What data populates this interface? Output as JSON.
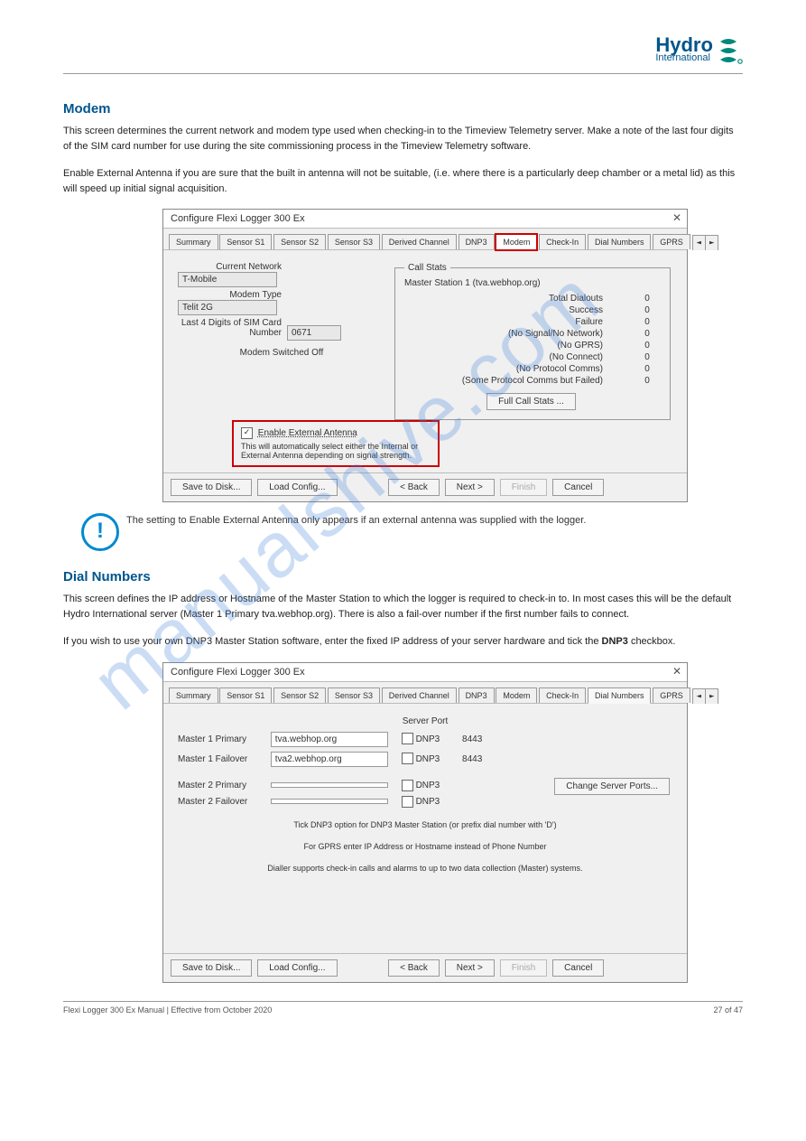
{
  "logo": {
    "brand": "Hydro",
    "sub": "International"
  },
  "sections": {
    "modem": {
      "heading": "Modem",
      "p1a": "This screen determines the current network and modem type used when checking-in to the Timeview Telemetry server. Make a note of the last four digits of the SIM card number for use during the site commissioning process in the Timeview Telemetry software.",
      "p1b": "Enable External Antenna if you are sure that the built in antenna will not be suitable, (i.e. where there is a particularly deep chamber or a metal lid) as this will speed up initial signal acquisition."
    },
    "dial": {
      "heading": "Dial Numbers",
      "p1": "This screen defines the IP address or Hostname of the Master Station to which the logger is required to check-in to. In most cases this will be the default Hydro International server (Master 1 Primary tva.webhop.org). There is also a fail-over number if the first number fails to connect.",
      "p2a": "If you wish to use your own DNP3 Master Station software, enter the fixed IP address of your server hardware and tick the ",
      "p2b": "DNP3",
      "p2c": " checkbox."
    }
  },
  "dialog1": {
    "title": "Configure Flexi Logger 300 Ex",
    "tabs": [
      "Summary",
      "Sensor S1",
      "Sensor S2",
      "Sensor S3",
      "Derived Channel",
      "DNP3",
      "Modem",
      "Check-In",
      "Dial Numbers",
      "GPRS"
    ],
    "left": {
      "currentNetworkLabel": "Current Network",
      "currentNetwork": "T-Mobile",
      "modemTypeLabel": "Modem Type",
      "modemType": "Telit 2G",
      "simLabel": "Last 4 Digits of SIM Card Number",
      "sim": "0671",
      "status": "Modem Switched Off"
    },
    "antenna": {
      "check": "✓",
      "label": "Enable External Antenna",
      "help": "This will automatically select either the Internal or External Antenna depending on signal strength."
    },
    "stats": {
      "legend": "Call Stats",
      "master": "Master Station 1 (tva.webhop.org)",
      "rows": [
        {
          "k": "Total Dialouts",
          "v": "0"
        },
        {
          "k": "Success",
          "v": "0"
        },
        {
          "k": "Failure",
          "v": "0"
        },
        {
          "k": "(No Signal/No Network)",
          "v": "0"
        },
        {
          "k": "(No GPRS)",
          "v": "0"
        },
        {
          "k": "(No Connect)",
          "v": "0"
        },
        {
          "k": "(No Protocol Comms)",
          "v": "0"
        },
        {
          "k": "(Some Protocol Comms but Failed)",
          "v": "0"
        }
      ],
      "button": "Full Call Stats ..."
    },
    "buttons": {
      "save": "Save to Disk...",
      "load": "Load Config...",
      "back": "< Back",
      "next": "Next >",
      "finish": "Finish",
      "cancel": "Cancel"
    }
  },
  "note": "The setting to Enable External Antenna only appears if an external antenna was supplied with the logger.",
  "dialog2": {
    "title": "Configure Flexi Logger 300 Ex",
    "tabs": [
      "Summary",
      "Sensor S1",
      "Sensor S2",
      "Sensor S3",
      "Derived Channel",
      "DNP3",
      "Modem",
      "Check-In",
      "Dial Numbers",
      "GPRS"
    ],
    "serverPort": "Server Port",
    "rows": [
      {
        "label": "Master 1 Primary",
        "val": "tva.webhop.org",
        "dnp": "DNP3",
        "port": "8443"
      },
      {
        "label": "Master 1 Failover",
        "val": "tva2.webhop.org",
        "dnp": "DNP3",
        "port": "8443"
      },
      {
        "label": "Master 2 Primary",
        "val": "",
        "dnp": "DNP3",
        "port": ""
      },
      {
        "label": "Master 2 Failover",
        "val": "",
        "dnp": "DNP3",
        "port": ""
      }
    ],
    "changePorts": "Change Server Ports...",
    "help1": "Tick DNP3 option for DNP3 Master Station (or prefix dial number with 'D')",
    "help2": "For GPRS enter IP Address or Hostname instead of Phone Number",
    "help3": "Dialler supports check-in calls and alarms to up to two data collection (Master) systems.",
    "buttons": {
      "save": "Save to Disk...",
      "load": "Load Config...",
      "back": "< Back",
      "next": "Next >",
      "finish": "Finish",
      "cancel": "Cancel"
    }
  },
  "footer": {
    "left": "Flexi Logger 300 Ex Manual | Effective from October 2020",
    "right": "27 of 47",
    "watermark": "manualshive.com"
  }
}
